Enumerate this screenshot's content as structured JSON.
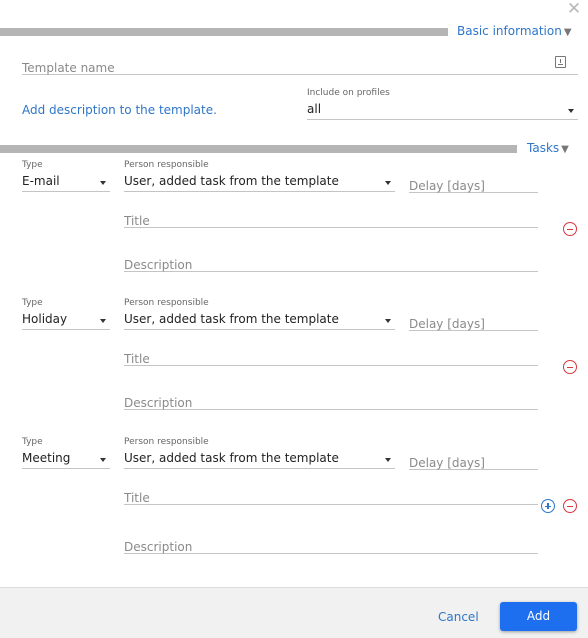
{
  "dialog": {
    "close_icon": "close-icon"
  },
  "basic_info": {
    "section_title": "Basic information",
    "template_name_placeholder": "Template name",
    "template_name_value": "",
    "add_description_link": "Add description to the template.",
    "include_on_profiles_label": "Include on profiles",
    "include_on_profiles_value": "all"
  },
  "tasks": {
    "section_title": "Tasks",
    "type_label": "Type",
    "person_label": "Person responsible",
    "delay_placeholder": "Delay [days]",
    "title_placeholder": "Title",
    "description_placeholder": "Description",
    "items": [
      {
        "type": "E-mail",
        "person": "User, added task from the template",
        "delay": "",
        "title": "",
        "description": ""
      },
      {
        "type": "Holiday",
        "person": "User, added task from the template",
        "delay": "",
        "title": "",
        "description": ""
      },
      {
        "type": "Meeting",
        "person": "User, added task from the template",
        "delay": "",
        "title": "",
        "description": ""
      }
    ]
  },
  "footer": {
    "cancel_label": "Cancel",
    "add_label": "Add"
  },
  "colors": {
    "accent": "#2f76c8",
    "primary_button": "#1d6ff0",
    "remove": "#d9363e",
    "section_bar": "#b5b5b5"
  }
}
